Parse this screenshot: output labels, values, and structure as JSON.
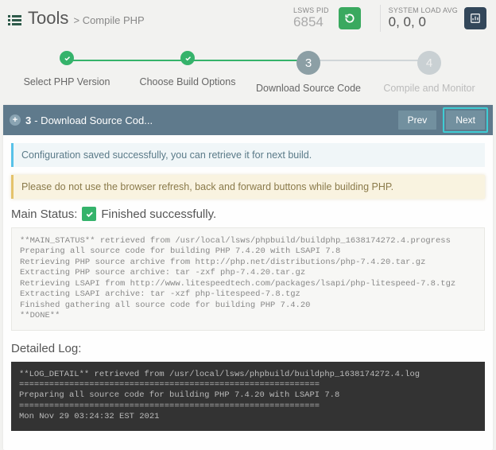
{
  "header": {
    "title": "Tools",
    "crumb": "> Compile PHP",
    "pid_label": "LSWS PID",
    "pid_value": "6854",
    "load_label": "SYSTEM LOAD AVG",
    "load_value": "0, 0, 0"
  },
  "steps": {
    "s1": "Select PHP Version",
    "s2": "Choose Build Options",
    "s3": "Download Source Code",
    "s4": "Compile and Monitor",
    "n3": "3",
    "n4": "4"
  },
  "bar": {
    "num": "3",
    "title": "- Download Source Cod...",
    "prev": "Prev",
    "next": "Next"
  },
  "alerts": {
    "ok": "Configuration saved successfully, you can retrieve it for next build.",
    "warn": "Please do not use the browser refresh, back and forward buttons while building PHP."
  },
  "main": {
    "label": "Main Status:",
    "value": "Finished successfully."
  },
  "log1": "**MAIN_STATUS** retrieved from /usr/local/lsws/phpbuild/buildphp_1638174272.4.progress\nPreparing all source code for building PHP 7.4.20 with LSAPI 7.8\nRetrieving PHP source archive from http://php.net/distributions/php-7.4.20.tar.gz\nExtracting PHP source archive: tar -zxf php-7.4.20.tar.gz\nRetrieving LSAPI from http://www.litespeedtech.com/packages/lsapi/php-litespeed-7.8.tgz\nExtracting LSAPI archive: tar -xzf php-litespeed-7.8.tgz\nFinished gathering all source code for building PHP 7.4.20\n**DONE**",
  "detail_label": "Detailed Log:",
  "log2": "**LOG_DETAIL** retrieved from /usr/local/lsws/phpbuild/buildphp_1638174272.4.log\n============================================================\nPreparing all source code for building PHP 7.4.20 with LSAPI 7.8\n============================================================\nMon Nov 29 03:24:32 EST 2021\n"
}
